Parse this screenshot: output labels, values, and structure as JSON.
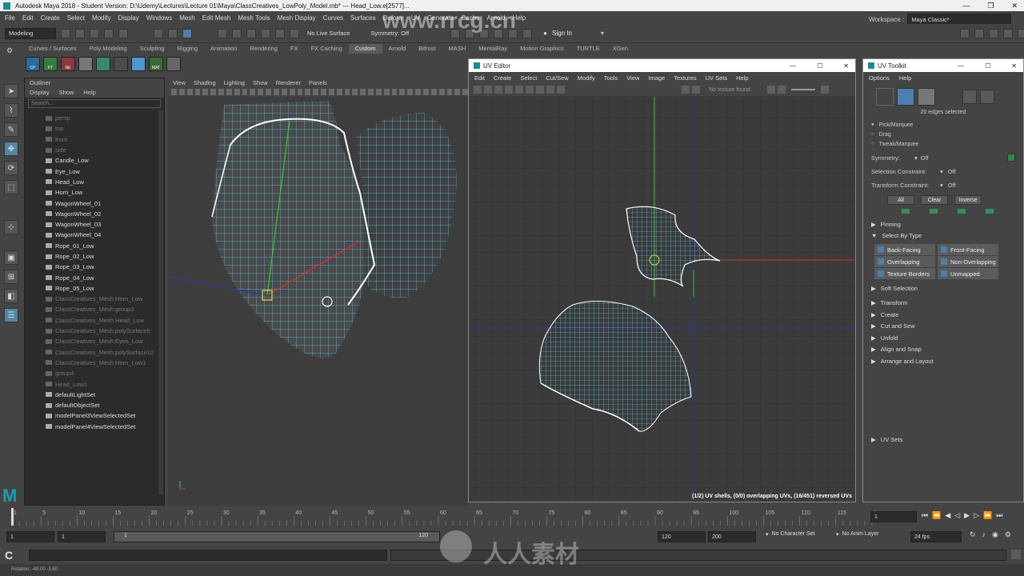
{
  "titlebar": {
    "text": "Autodesk Maya 2018 - Student Version: D:\\Udemy\\Lectures\\Lecture 01\\Maya\\ClassCreatives_LowPoly_Model.mb*   ---  Head_Low.e[2577]..."
  },
  "menubar": {
    "items": [
      "File",
      "Edit",
      "Create",
      "Select",
      "Modify",
      "Display",
      "Windows",
      "Mesh",
      "Edit Mesh",
      "Mesh Tools",
      "Mesh Display",
      "Curves",
      "Surfaces",
      "Deform",
      "UV",
      "Generate",
      "Cache",
      "Arnold",
      "Help"
    ],
    "workspace_label": "Workspace :",
    "workspace_value": "Maya Classic*"
  },
  "statusline": {
    "mode": "Modeling",
    "live_surface": "No Live Surface",
    "symmetry": "Symmetry: Off",
    "sign_in": "Sign In"
  },
  "shelf": {
    "tabs": [
      "Curves / Surfaces",
      "Poly Modeling",
      "Sculpting",
      "Rigging",
      "Animation",
      "Rendering",
      "FX",
      "FX Caching",
      "Custom",
      "Arnold",
      "Bifrost",
      "MASH",
      "MentalRay",
      "Motion Graphics",
      "TURTLE",
      "XGen"
    ],
    "active": "Custom",
    "buttons": [
      "CP",
      "FT",
      "NE",
      "",
      "",
      "",
      "",
      "MAT",
      ""
    ]
  },
  "outliner": {
    "title": "Outliner",
    "menu": [
      "Display",
      "Show",
      "Help"
    ],
    "search_placeholder": "Search...",
    "items": [
      {
        "label": "persp",
        "dim": true
      },
      {
        "label": "top",
        "dim": true
      },
      {
        "label": "front",
        "dim": true
      },
      {
        "label": "side",
        "dim": true
      },
      {
        "label": "Candle_Low",
        "dim": false
      },
      {
        "label": "Eye_Low",
        "dim": false
      },
      {
        "label": "Head_Low",
        "dim": false
      },
      {
        "label": "Horn_Low",
        "dim": false
      },
      {
        "label": "WagonWheel_01",
        "dim": false
      },
      {
        "label": "WagonWheel_02",
        "dim": false
      },
      {
        "label": "WagonWheel_03",
        "dim": false
      },
      {
        "label": "WagonWheel_04",
        "dim": false
      },
      {
        "label": "Rope_01_Low",
        "dim": false
      },
      {
        "label": "Rope_02_Low",
        "dim": false
      },
      {
        "label": "Rope_03_Low",
        "dim": false
      },
      {
        "label": "Rope_04_Low",
        "dim": false
      },
      {
        "label": "Rope_05_Low",
        "dim": false
      },
      {
        "label": "ClassCreatives_Mesh:Horn_Low",
        "dim": true
      },
      {
        "label": "ClassCreatives_Mesh:group3",
        "dim": true
      },
      {
        "label": "ClassCreatives_Mesh:Head_Low",
        "dim": true
      },
      {
        "label": "ClassCreatives_Mesh:polySurface5",
        "dim": true
      },
      {
        "label": "ClassCreatives_Mesh:Eyes_Low",
        "dim": true
      },
      {
        "label": "ClassCreatives_Mesh:polySurface10",
        "dim": true
      },
      {
        "label": "ClassCreatives_Mesh:Horn_Low1",
        "dim": true
      },
      {
        "label": "group4",
        "dim": true
      },
      {
        "label": "Head_Low1",
        "dim": true
      },
      {
        "label": "defaultLightSet",
        "dim": false
      },
      {
        "label": "defaultObjectSet",
        "dim": false
      },
      {
        "label": "modelPanel3ViewSelectedSet",
        "dim": false
      },
      {
        "label": "modelPanel4ViewSelectedSet",
        "dim": false
      }
    ]
  },
  "viewport": {
    "menu": [
      "View",
      "Shading",
      "Lighting",
      "Show",
      "Renderer",
      "Panels"
    ]
  },
  "uv_editor": {
    "title": "UV Editor",
    "menu": [
      "Edit",
      "Create",
      "Select",
      "Cut/Sew",
      "Modify",
      "Tools",
      "View",
      "Image",
      "Textures",
      "UV Sets",
      "Help"
    ],
    "texture_status": "No texture found",
    "status": "(1/2) UV shells, (0/0) overlapping UVs, (16/451) reversed UVs"
  },
  "uv_toolkit": {
    "title": "UV Toolkit",
    "menu": [
      "Options",
      "Help"
    ],
    "selection_info": "20 edges selected",
    "modes": [
      "Pick/Marquee",
      "Drag",
      "Tweak/Marquee"
    ],
    "symmetry_label": "Symmetry:",
    "symmetry_value": "Off",
    "sel_constraint_label": "Selection Constraint:",
    "sel_constraint_value": "Off",
    "xf_constraint_label": "Transform Constraint:",
    "xf_constraint_value": "Off",
    "buttons": [
      "All",
      "Clear",
      "Inverse"
    ],
    "pinning": "Pinning",
    "select_by_type": "Select By Type",
    "type_buttons": [
      "Back-Facing",
      "Front-Facing",
      "Overlapping",
      "Non-Overlapping",
      "Texture Borders",
      "Unmapped"
    ],
    "soft_selection": "Soft Selection",
    "sections": [
      "Transform",
      "Create",
      "Cut and Sew",
      "Unfold",
      "Align and Snap",
      "Arrange and Layout"
    ],
    "uv_sets": "UV Sets"
  },
  "timeline": {
    "ticks": [
      "1",
      "5",
      "10",
      "15",
      "20",
      "25",
      "30",
      "35",
      "40",
      "45",
      "50",
      "55",
      "60",
      "65",
      "70",
      "75",
      "80",
      "85",
      "90",
      "95",
      "100",
      "105",
      "110",
      "115",
      "120"
    ],
    "current_frame": "1"
  },
  "range": {
    "start": "1",
    "playback_start": "1",
    "slider_start": "1",
    "slider_end": "120",
    "playback_end": "120",
    "end": "200",
    "character_set": "No Character Set",
    "anim_layer": "No Anim Layer",
    "fps": "24 fps"
  },
  "helpline": {
    "text": "Rotation:  -48.00     -3.60"
  },
  "watermark": {
    "url": "www.rrcg.cn",
    "brand": "人人素材"
  }
}
